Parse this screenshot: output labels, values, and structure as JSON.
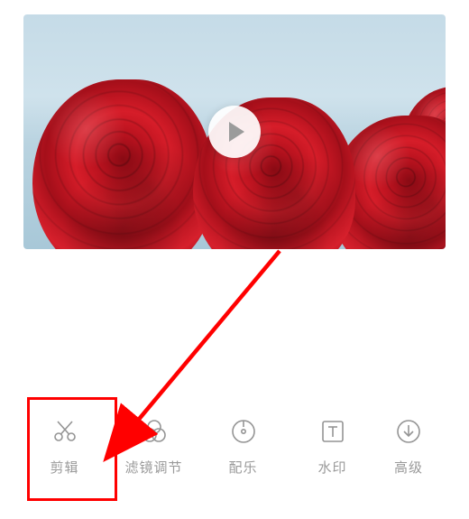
{
  "video": {
    "play_visible": true
  },
  "toolbar": {
    "items": [
      {
        "label": "剪辑",
        "icon": "scissors"
      },
      {
        "label": "滤镜调节",
        "icon": "overlap-circles"
      },
      {
        "label": "配乐",
        "icon": "disc"
      },
      {
        "label": "水印",
        "icon": "text-box"
      },
      {
        "label": "高级",
        "icon": "download-circle"
      }
    ]
  },
  "annotation": {
    "highlight_index": 0,
    "highlight_color": "#ff0000",
    "arrow_color": "#ff0000"
  }
}
